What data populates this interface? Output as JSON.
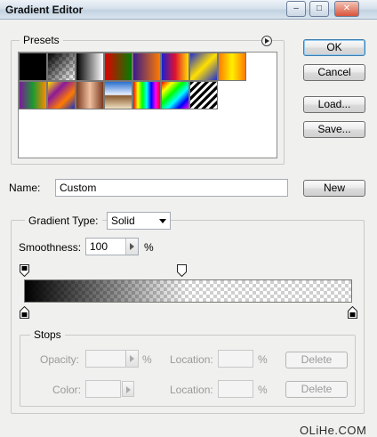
{
  "window": {
    "title": "Gradient Editor",
    "controls": {
      "minimize": "–",
      "maximize": "□",
      "close": "✕"
    }
  },
  "presets": {
    "legend": "Presets",
    "menu_icon": "circle-arrow-right-icon",
    "swatches": [
      {
        "name": "black-to-white",
        "css": "linear-gradient(90deg,#000,#000)"
      },
      {
        "name": "foreground-to-transparent",
        "css": "linear-gradient(135deg,#000 0%,rgba(0,0,0,0) 100%)"
      },
      {
        "name": "black-white",
        "css": "linear-gradient(90deg,#000,#fff)"
      },
      {
        "name": "red-green",
        "css": "linear-gradient(90deg,#e00000,#007f00)"
      },
      {
        "name": "violet-orange",
        "css": "linear-gradient(90deg,#3a1a8a,#ff7a00)"
      },
      {
        "name": "blue-red-yellow",
        "css": "linear-gradient(90deg,#1a20d0,#e01030,#ffe000)"
      },
      {
        "name": "blue-yellow-blue",
        "css": "linear-gradient(135deg,#1f2fd0 0%,#ffe000 50%,#1f2fd0 100%)"
      },
      {
        "name": "orange-yellow-orange",
        "css": "linear-gradient(90deg,#ff7a00,#fff000,#ff7a00)"
      },
      {
        "name": "violet-green-orange",
        "css": "linear-gradient(90deg,#7a1a9a,#1a9a30,#ff8a00)"
      },
      {
        "name": "yellow-violet-orange-blue",
        "css": "linear-gradient(135deg,#ffe000,#8a1a9a,#ff7a00,#1a30c0)"
      },
      {
        "name": "copper",
        "css": "linear-gradient(90deg,#7a3a20,#f0c0a0,#7a3a20)"
      },
      {
        "name": "chrome",
        "css": "linear-gradient(180deg,#2a6fd0 0%,#e8f0ff 48%,#8a5a30 52%,#f0e0c0 100%)"
      },
      {
        "name": "spectrum",
        "css": "linear-gradient(90deg,#f00,#ff0,#0f0,#0ff,#00f,#f0f,#f00)"
      },
      {
        "name": "transparent-rainbow",
        "css": "linear-gradient(135deg,#f00,#ff0,#0f0,#0ff,#00f,#f0f)"
      },
      {
        "name": "transparent-stripes",
        "css": "repeating-linear-gradient(135deg,#000 0 3px,#fff 3px 6px)"
      }
    ]
  },
  "buttons": {
    "ok": "OK",
    "cancel": "Cancel",
    "load": "Load...",
    "save": "Save...",
    "new": "New",
    "delete": "Delete"
  },
  "name_field": {
    "label": "Name:",
    "value": "Custom"
  },
  "gradient": {
    "type_label": "Gradient Type:",
    "type_value": "Solid",
    "smoothness_label": "Smoothness:",
    "smoothness_value": "100",
    "smoothness_unit": "%",
    "opacity_stops": [
      0,
      0.48
    ],
    "color_stops": [
      0,
      1
    ]
  },
  "stops": {
    "legend": "Stops",
    "opacity_label": "Opacity:",
    "opacity_unit": "%",
    "location_label": "Location:",
    "location_unit": "%",
    "color_label": "Color:"
  },
  "watermark": "OLiHe.COM"
}
